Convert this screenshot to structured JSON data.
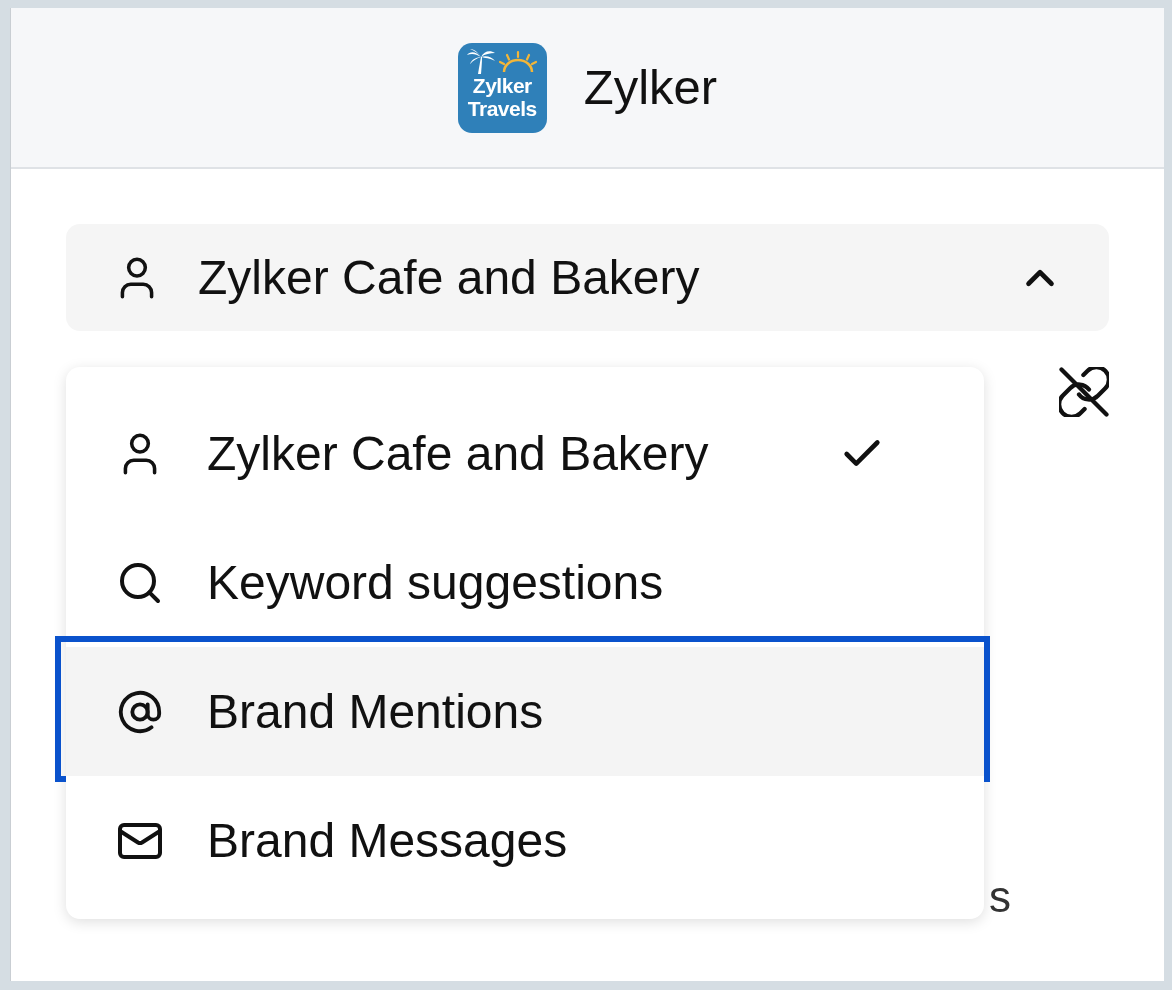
{
  "header": {
    "logo": {
      "line_1": "Zylker",
      "line_2": "Travels"
    },
    "title": "Zylker"
  },
  "account_select": {
    "value": "Zylker Cafe and Bakery",
    "expanded": true
  },
  "menu": {
    "items": [
      {
        "kind": "account",
        "label": "Zylker Cafe and Bakery",
        "selected": true,
        "highlighted": false
      },
      {
        "kind": "search",
        "label": "Keyword suggestions",
        "selected": false,
        "highlighted": false
      },
      {
        "kind": "mention",
        "label": "Brand Mentions",
        "selected": false,
        "highlighted": true
      },
      {
        "kind": "message",
        "label": "Brand Messages",
        "selected": false,
        "highlighted": false
      }
    ]
  },
  "covered_text": "s"
}
